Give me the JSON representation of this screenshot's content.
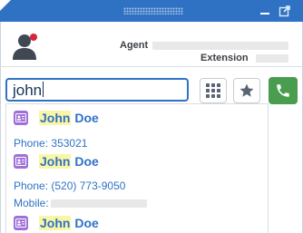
{
  "colors": {
    "titlebar": "#2f72c4",
    "accent": "#2f72c4",
    "call": "#4a9d4f",
    "status": "#d9263b",
    "contact": "#9f70d8",
    "highlight": "#faf6a8"
  },
  "titlebar": {
    "minimize_icon": "minimize-icon",
    "popout_icon": "popout-icon"
  },
  "agent": {
    "agent_label": "Agent",
    "extension_label": "Extension",
    "status_color": "red"
  },
  "search": {
    "value": "john"
  },
  "buttons": {
    "dialpad_icon": "dialpad-icon",
    "favorites_icon": "star-icon",
    "call_icon": "phone-icon"
  },
  "results": [
    {
      "highlight": "John",
      "rest": " Doe",
      "details": [
        {
          "label": "Phone:",
          "value": "353021"
        }
      ]
    },
    {
      "highlight": "John",
      "rest": " Doe",
      "details": [
        {
          "label": "Phone:",
          "value": "(520) 773-9050"
        },
        {
          "label": "Mobile:",
          "value": ""
        }
      ]
    },
    {
      "highlight": "John",
      "rest": " Doe",
      "details": []
    }
  ]
}
